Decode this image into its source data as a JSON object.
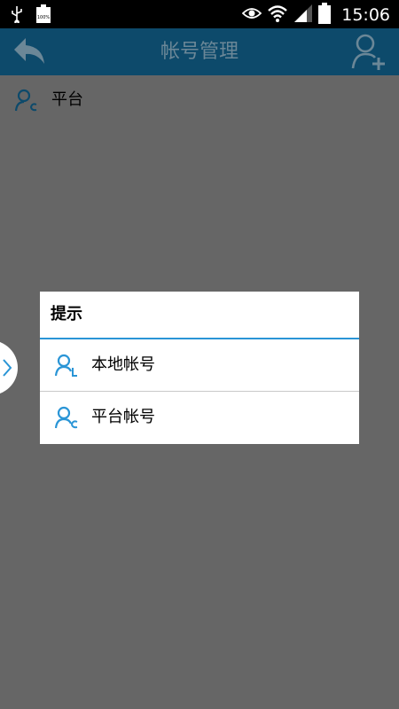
{
  "status_bar": {
    "time": "15:06",
    "battery_badge": "100%"
  },
  "app_bar": {
    "title": "帐号管理"
  },
  "content": {
    "items": [
      {
        "label": "平台"
      }
    ]
  },
  "dialog": {
    "title": "提示",
    "options": [
      {
        "label": "本地帐号",
        "icon": "user-local-icon"
      },
      {
        "label": "平台帐号",
        "icon": "user-cloud-icon"
      }
    ]
  },
  "colors": {
    "app_bar": "#0d4a6b",
    "accent": "#2a95d6",
    "overlay": "#666666",
    "title_text": "#6b8797"
  }
}
